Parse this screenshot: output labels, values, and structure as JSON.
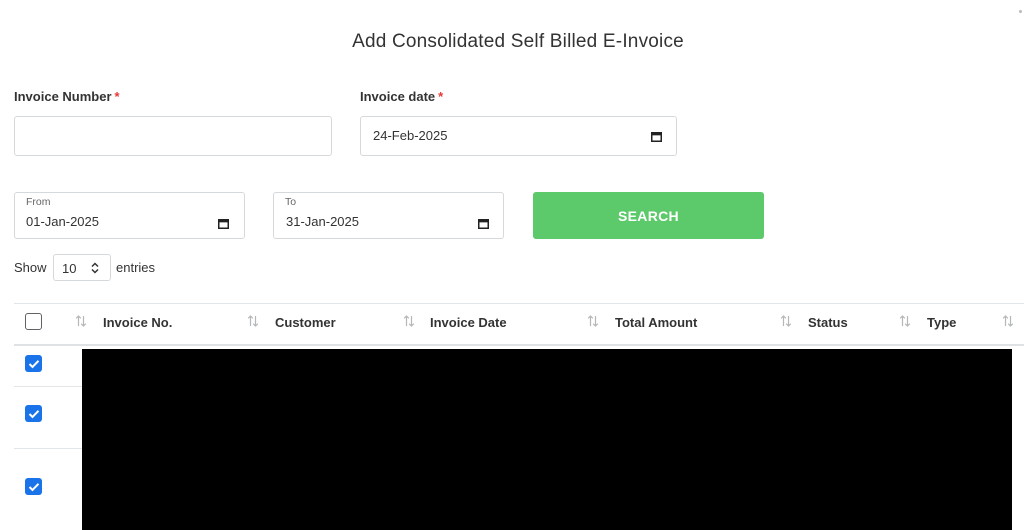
{
  "page": {
    "title": "Add Consolidated Self Billed E-Invoice"
  },
  "form": {
    "invoice_number": {
      "label": "Invoice Number",
      "required_mark": "*",
      "value": "",
      "placeholder": ""
    },
    "invoice_date": {
      "label": "Invoice date",
      "required_mark": "*",
      "value": "24-Feb-2025"
    },
    "from_date": {
      "label": "From",
      "value": "01-Jan-2025"
    },
    "to_date": {
      "label": "To",
      "value": "31-Jan-2025"
    },
    "search_label": "SEARCH"
  },
  "entries": {
    "show_label": "Show",
    "selected": "10",
    "suffix_label": "entries"
  },
  "table": {
    "columns": [
      "Invoice No.",
      "Customer",
      "Invoice Date",
      "Total Amount",
      "Status",
      "Type"
    ],
    "select_all_checked": false,
    "rows_checked": [
      true,
      true,
      true
    ]
  },
  "colors": {
    "search_button": "#5cc96b",
    "checkbox_checked": "#1a73e8",
    "required_mark": "#e53935"
  }
}
